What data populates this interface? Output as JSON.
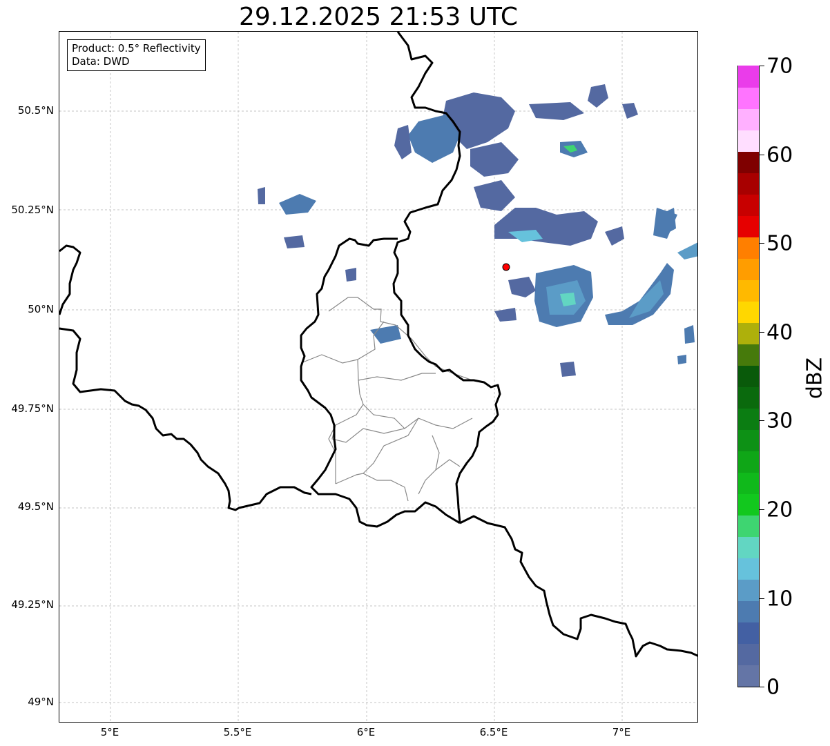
{
  "title": "29.12.2025 21:53 UTC",
  "info": {
    "product": "Product: 0.5° Reflectivity",
    "source": "Data: DWD"
  },
  "map": {
    "lon_range": [
      4.8,
      7.3
    ],
    "lat_range": [
      48.95,
      50.7
    ],
    "lat_labels": [
      "49°N",
      "49.25°N",
      "49.5°N",
      "49.75°N",
      "50°N",
      "50.25°N",
      "50.5°N"
    ],
    "lon_labels": [
      "5°E",
      "5.5°E",
      "6°E",
      "6.5°E",
      "7°E"
    ],
    "grid": "dashed",
    "radar_site": {
      "lon": 6.547,
      "lat": 50.11,
      "color": "#ff0000"
    },
    "border_color": "#000000",
    "admin_border_color": "#888888"
  },
  "colorbar": {
    "label": "dBZ",
    "min": 0,
    "max": 70,
    "ticks": [
      "0",
      "10",
      "20",
      "30",
      "40",
      "50",
      "60",
      "70"
    ],
    "colors": [
      "#6475a6",
      "#5469a1",
      "#4360a3",
      "#4d7bb0",
      "#5b9cc7",
      "#66c2dc",
      "#62d6c2",
      "#3ed571",
      "#12c81e",
      "#10b91b",
      "#0fa617",
      "#0d9115",
      "#0b7d12",
      "#0a6a0d",
      "#095a0a",
      "#467a0b",
      "#aeb00b",
      "#ffd700",
      "#ffb900",
      "#ff9d00",
      "#ff7f00",
      "#e60000",
      "#c80000",
      "#a80000",
      "#7f0000",
      "#ffdeff",
      "#ffb0ff",
      "#ff74ff",
      "#ea3cea"
    ]
  }
}
